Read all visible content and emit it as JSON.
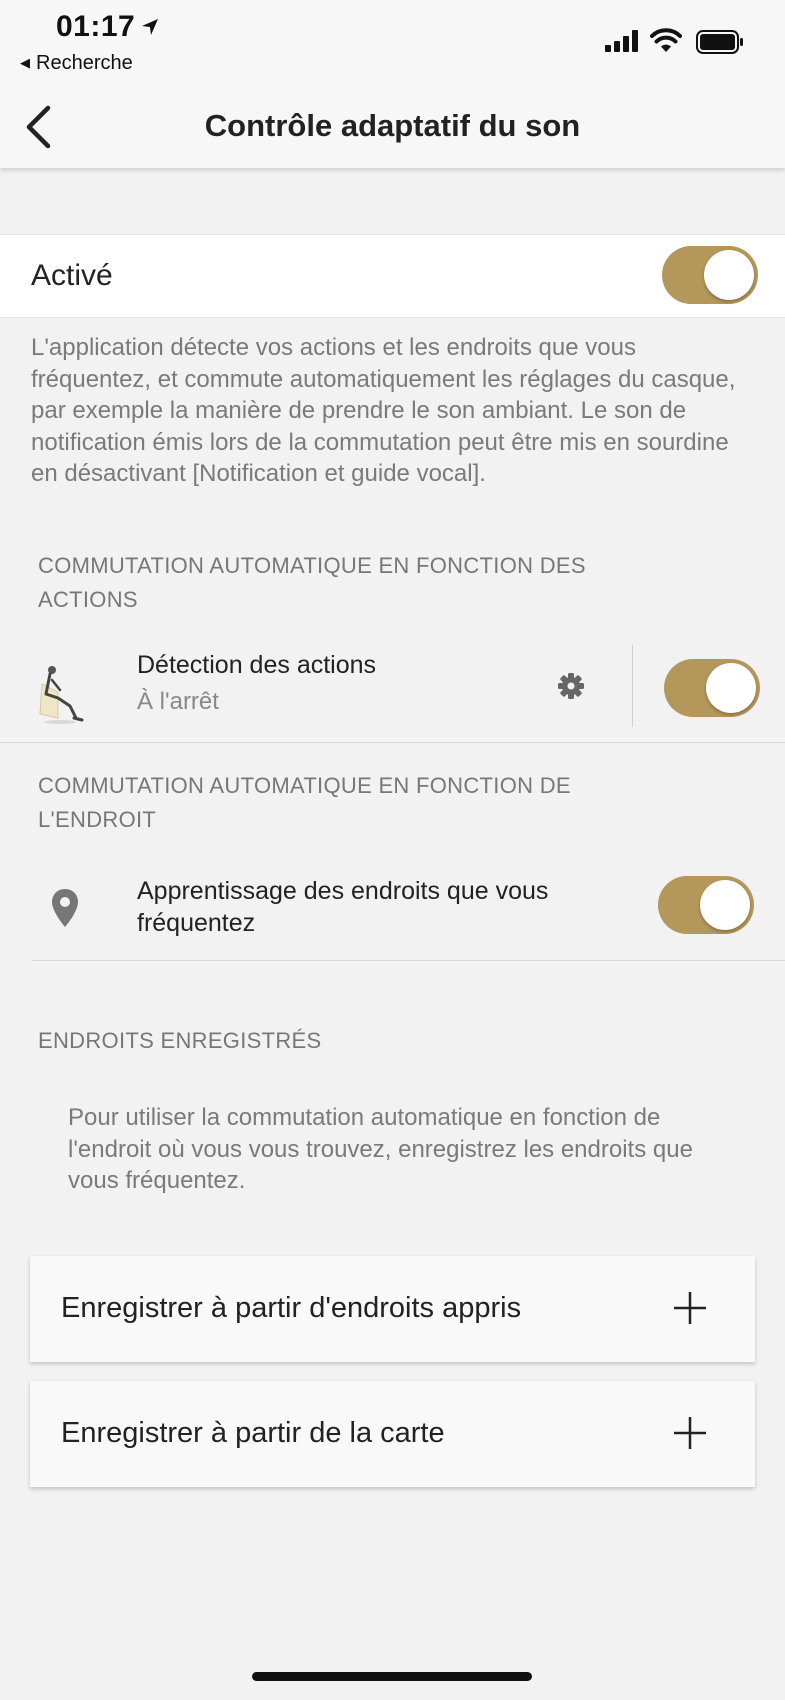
{
  "status": {
    "time": "01:17",
    "back_app": "Recherche"
  },
  "nav": {
    "title": "Contrôle adaptatif du son"
  },
  "activated": {
    "label": "Activé",
    "on": true
  },
  "description": "L'application détecte vos actions et les endroits que vous fréquentez, et commute automatiquement les réglages du casque, par exemple la manière de prendre le son ambiant. Le son de notification émis lors de la commutation peut être mis en sourdine en désactivant [Notification et guide vocal].",
  "actions_section": {
    "header": "COMMUTATION AUTOMATIQUE EN FONCTION DES ACTIONS",
    "row_title": "Détection des actions",
    "row_sub": "À l'arrêt",
    "on": true
  },
  "location_section": {
    "header": "COMMUTATION AUTOMATIQUE EN FONCTION DE L'ENDROIT",
    "row_title": "Apprentissage des endroits que vous fréquentez",
    "on": true
  },
  "saved_section": {
    "header": "ENDROITS ENREGISTRÉS",
    "info": "Pour utiliser la commutation automatique en fonction de l'endroit où vous vous trouvez, enregistrez les endroits que vous fréquentez.",
    "buttons": [
      {
        "label": "Enregistrer à partir d'endroits appris"
      },
      {
        "label": "Enregistrer à partir de la carte"
      }
    ]
  },
  "colors": {
    "accent": "#b4975a",
    "background": "#f2f2f2"
  }
}
